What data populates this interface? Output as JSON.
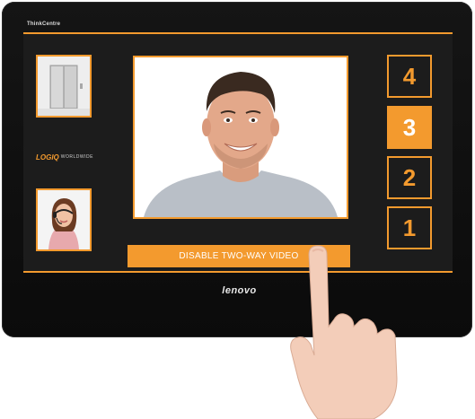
{
  "monitor": {
    "brand_top": "ThinkCentre",
    "brand_bottom": "lenovo"
  },
  "sidebar": {
    "thumbnails": [
      {
        "name": "elevator-camera",
        "icon": "elevator-door-icon"
      },
      {
        "name": "support-agent",
        "icon": "headset-agent-icon"
      }
    ],
    "logo": {
      "word": "LOGIQ",
      "sub": "WORLDWIDE"
    }
  },
  "video": {
    "disable_label": "DISABLE TWO-WAY VIDEO"
  },
  "floors": {
    "buttons": [
      {
        "label": "4",
        "active": false
      },
      {
        "label": "3",
        "active": true
      },
      {
        "label": "2",
        "active": false
      },
      {
        "label": "1",
        "active": false
      }
    ]
  },
  "colors": {
    "accent": "#f39a2e",
    "bezel": "#111111",
    "screen": "#1c1c1c"
  }
}
